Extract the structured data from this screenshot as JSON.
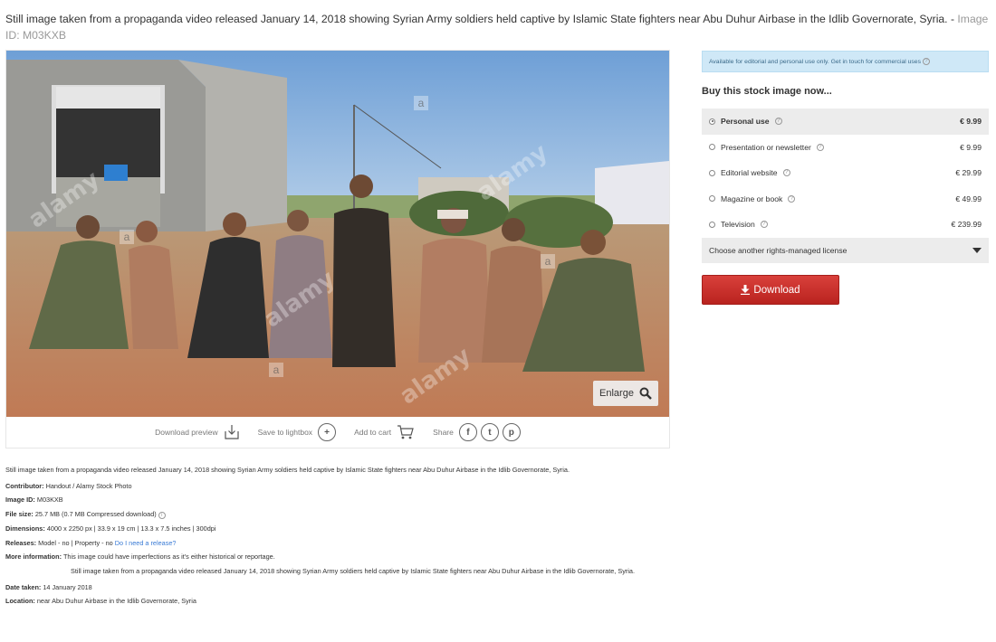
{
  "page": {
    "title": "Still image taken from a propaganda video released January 14, 2018 showing Syrian Army soldiers held captive by Islamic State fighters near Abu Duhur Airbase in the Idlib Governorate, Syria. -",
    "image_id_label": "Image ID: M03KXB"
  },
  "photo": {
    "enlarge_label": "Enlarge"
  },
  "actions": {
    "download_preview": "Download preview",
    "save_to_lightbox": "Save to lightbox",
    "add_to_cart": "Add to cart",
    "share": "Share"
  },
  "details": {
    "description": "Still image taken from a propaganda video released January 14, 2018 showing Syrian Army soldiers held captive by Islamic State fighters near Abu Duhur Airbase in the Idlib Governorate, Syria.",
    "contributor_label": "Contributor:",
    "contributor": "Handout / Alamy Stock Photo",
    "image_id_label": "Image ID:",
    "image_id": "M03KXB",
    "file_size_label": "File size:",
    "file_size": "25.7 MB (0.7 MB Compressed download)",
    "dimensions_label": "Dimensions:",
    "dimensions": "4000 x 2250 px | 33.9 x 19 cm | 13.3 x 7.5 inches | 300dpi",
    "releases_label": "Releases:",
    "releases": "Model - no | Property - no",
    "release_link": "Do I need a release?",
    "more_info_label": "More information:",
    "more_info": "This image could have imperfections as it's either historical or reportage.",
    "more_info_desc": "Still image taken from a propaganda video released January 14, 2018 showing Syrian Army soldiers held captive by Islamic State fighters near Abu Duhur Airbase in the Idlib Governorate, Syria.",
    "date_taken_label": "Date taken:",
    "date_taken": "14 January 2018",
    "location_label": "Location:",
    "location": "near Abu Duhur Airbase in the Idlib Governorate, Syria"
  },
  "sidebar": {
    "notice": "Available for editorial and personal use only. Get in touch for commercial uses",
    "buy_title": "Buy this stock image now...",
    "licenses": [
      {
        "label": "Personal use",
        "price": "€ 9.99",
        "selected": true
      },
      {
        "label": "Presentation or newsletter",
        "price": "€ 9.99",
        "selected": false
      },
      {
        "label": "Editorial website",
        "price": "€ 29.99",
        "selected": false
      },
      {
        "label": "Magazine or book",
        "price": "€ 49.99",
        "selected": false
      },
      {
        "label": "Television",
        "price": "€ 239.99",
        "selected": false
      }
    ],
    "choose_other": "Choose another rights-managed license",
    "download_label": "Download"
  },
  "colors": {
    "accent_red": "#c8302b",
    "notice_bg": "#cfe8f7",
    "link_blue": "#3a7bd5"
  }
}
